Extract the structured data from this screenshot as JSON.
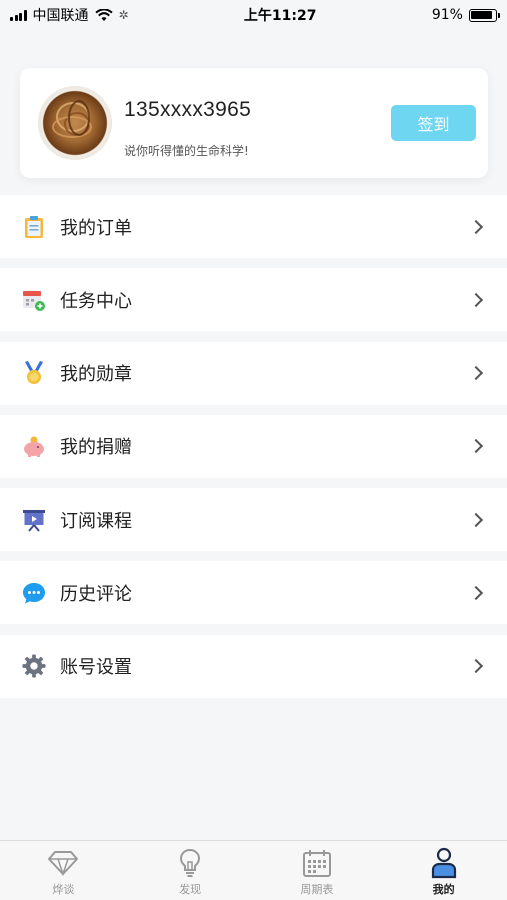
{
  "status_bar": {
    "carrier": "中国联通",
    "time": "上午11:27",
    "battery": "91%"
  },
  "profile": {
    "phone": "135xxxx3965",
    "slogan": "说你听得懂的生命科学!",
    "checkin_label": "签到",
    "accent_color": "#6fd6f2"
  },
  "menu": [
    {
      "label": "我的订单",
      "icon": "clipboard-icon"
    },
    {
      "label": "任务中心",
      "icon": "calendar-add-icon"
    },
    {
      "label": "我的勋章",
      "icon": "medal-icon"
    },
    {
      "label": "我的捐赠",
      "icon": "piggy-bank-icon"
    },
    {
      "label": "订阅课程",
      "icon": "presentation-icon"
    },
    {
      "label": "历史评论",
      "icon": "chat-bubble-icon"
    },
    {
      "label": "账号设置",
      "icon": "gear-icon"
    }
  ],
  "tabs": [
    {
      "label": "烨谈",
      "icon": "diamond-icon",
      "active": false
    },
    {
      "label": "发现",
      "icon": "lightbulb-icon",
      "active": false
    },
    {
      "label": "周期表",
      "icon": "calendar-grid-icon",
      "active": false
    },
    {
      "label": "我的",
      "icon": "user-icon",
      "active": true
    }
  ]
}
